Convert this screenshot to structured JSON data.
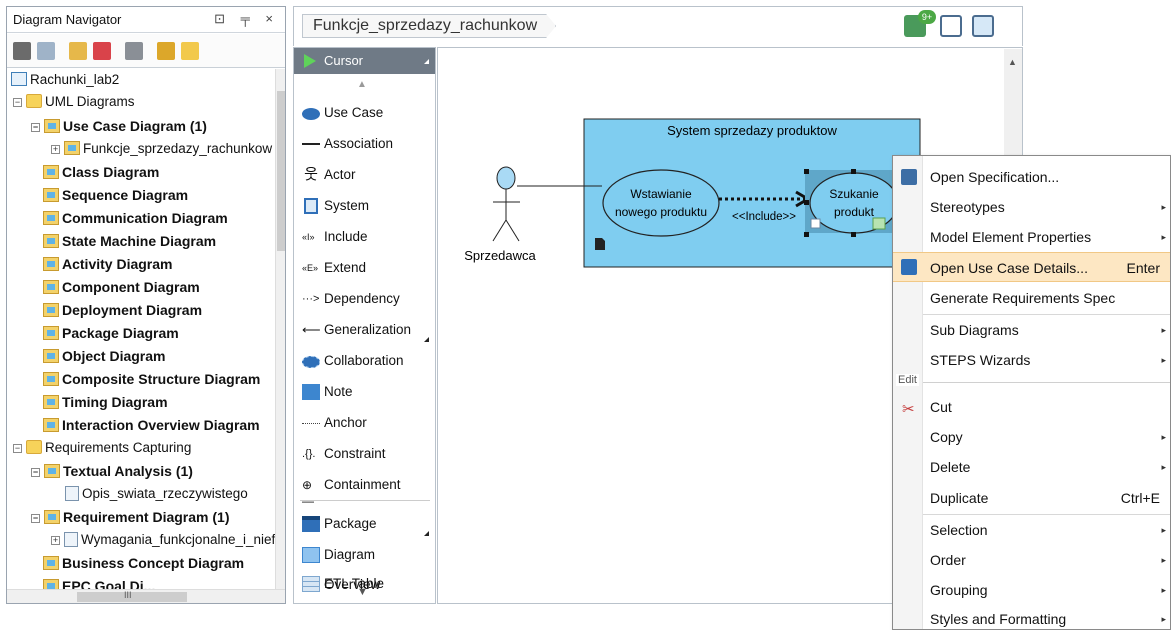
{
  "navigator": {
    "title": "Diagram Navigator",
    "window_buttons": "⊡ ╤ ×",
    "tree": [
      {
        "label": "Rachunki_lab2",
        "bold": false
      },
      {
        "label": "UML Diagrams",
        "bold": false
      },
      {
        "label": "Use Case Diagram (1)",
        "bold": true
      },
      {
        "label": "Funkcje_sprzedazy_rachunkow",
        "bold": false
      },
      {
        "label": "Class Diagram",
        "bold": true
      },
      {
        "label": "Sequence Diagram",
        "bold": true
      },
      {
        "label": "Communication Diagram",
        "bold": true
      },
      {
        "label": "State Machine Diagram",
        "bold": true
      },
      {
        "label": "Activity Diagram",
        "bold": true
      },
      {
        "label": "Component Diagram",
        "bold": true
      },
      {
        "label": "Deployment Diagram",
        "bold": true
      },
      {
        "label": "Package Diagram",
        "bold": true
      },
      {
        "label": "Object Diagram",
        "bold": true
      },
      {
        "label": "Composite Structure Diagram",
        "bold": true
      },
      {
        "label": "Timing Diagram",
        "bold": true
      },
      {
        "label": "Interaction Overview Diagram",
        "bold": true
      },
      {
        "label": "Requirements Capturing",
        "bold": false
      },
      {
        "label": "Textual Analysis (1)",
        "bold": true
      },
      {
        "label": "Opis_swiata_rzeczywistego",
        "bold": false
      },
      {
        "label": "Requirement Diagram (1)",
        "bold": true
      },
      {
        "label": "Wymagania_funkcjonalne_i_nief",
        "bold": false
      },
      {
        "label": "Business Concept Diagram",
        "bold": true
      },
      {
        "label": "EPC Goal Di...",
        "bold": true
      }
    ],
    "hscroll_grip": "III"
  },
  "tab": {
    "label": "Funkcje_sprzedazy_rachunkow",
    "badge": "9+"
  },
  "palette": {
    "cursor": "Cursor",
    "items": [
      "Use Case",
      "Association",
      "Actor",
      "System",
      "Include",
      "Extend",
      "Dependency",
      "Generalization",
      "Collaboration",
      "Note",
      "Anchor",
      "Constraint",
      "Containment",
      "Package",
      "Diagram Overview",
      "ETL Table"
    ]
  },
  "diagram": {
    "system_title": "System sprzedazy produktow",
    "actor_name": "Sprzedawca",
    "usecase1_line1": "Wstawianie",
    "usecase1_line2": "nowego produktu",
    "usecase2_line1": "Szukanie",
    "usecase2_line2": "produkt",
    "include_label": "<<Include>>"
  },
  "context_menu": {
    "items": [
      {
        "label": "Open Specification...",
        "shortcut": "",
        "submenu": false
      },
      {
        "label": "Stereotypes",
        "shortcut": "",
        "submenu": true
      },
      {
        "label": "Model Element Properties",
        "shortcut": "",
        "submenu": true
      },
      {
        "label": "Open Use Case Details...",
        "shortcut": "Enter",
        "submenu": false,
        "highlight": true
      },
      {
        "label": "Generate Requirements Spec",
        "shortcut": "",
        "submenu": false
      },
      {
        "label": "Sub Diagrams",
        "shortcut": "",
        "submenu": true
      },
      {
        "label": "STEPS Wizards",
        "shortcut": "",
        "submenu": true
      },
      {
        "label": "Cut",
        "shortcut": "",
        "submenu": false
      },
      {
        "label": "Copy",
        "shortcut": "",
        "submenu": true
      },
      {
        "label": "Delete",
        "shortcut": "",
        "submenu": true
      },
      {
        "label": "Duplicate",
        "shortcut": "Ctrl+E",
        "submenu": false
      },
      {
        "label": "Selection",
        "shortcut": "",
        "submenu": true
      },
      {
        "label": "Order",
        "shortcut": "",
        "submenu": true
      },
      {
        "label": "Grouping",
        "shortcut": "",
        "submenu": true
      },
      {
        "label": "Styles and Formatting",
        "shortcut": "",
        "submenu": true
      }
    ],
    "edit_header": "Edit"
  },
  "colors": {
    "system_fill": "#7fcdf0",
    "highlight": "#fde7c3",
    "palette_cursor": "#6f7a86"
  }
}
